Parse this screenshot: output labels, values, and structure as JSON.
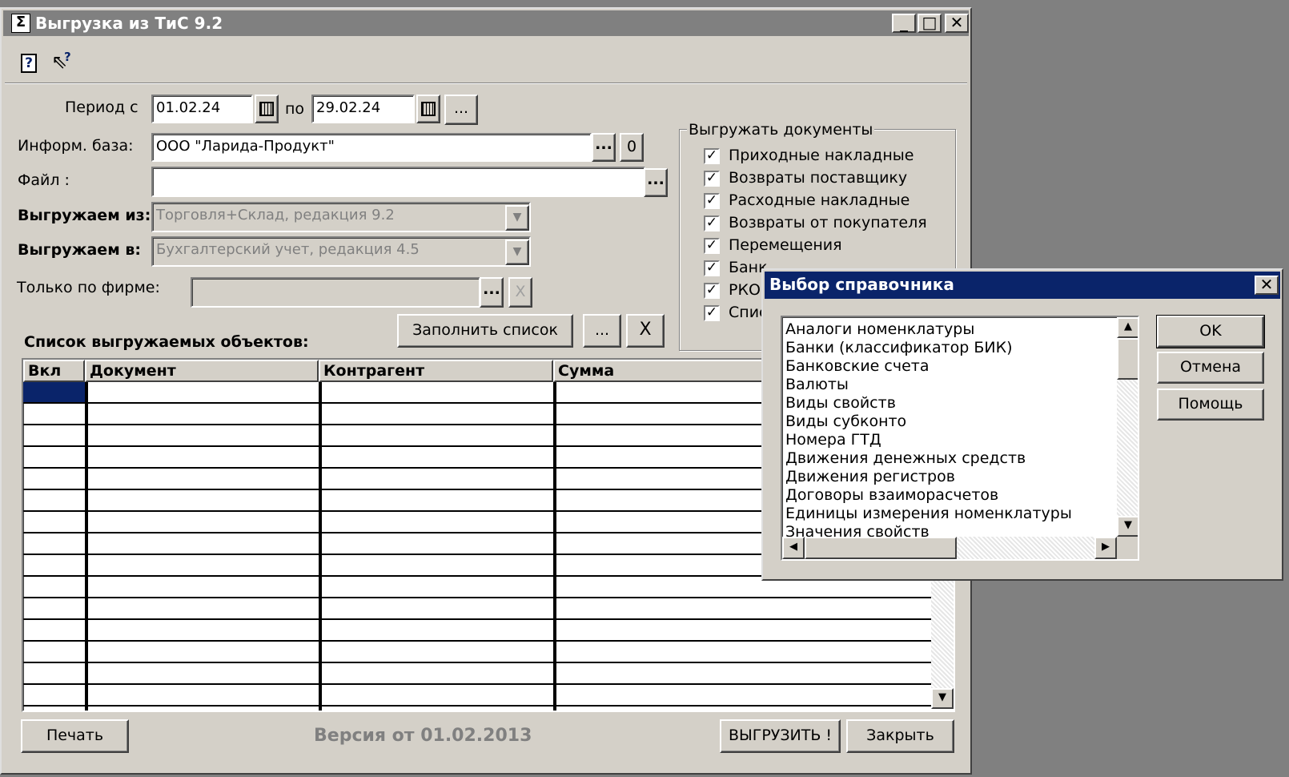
{
  "main_window": {
    "title": "Выгрузка из ТиС 9.2",
    "toolbar": {
      "help_icon": "help-book-icon",
      "whats_this_icon": "whats-this-cursor-icon"
    },
    "period_label": "Период с",
    "period_from": "01.02.24",
    "period_to_label": "по",
    "period_to": "29.02.24",
    "ellipsis": "...",
    "info_base_label": "Информ. база:",
    "info_base_value": "ООО \"Ларида-Продукт\"",
    "info_base_zero": "0",
    "file_label": "Файл :",
    "file_value": "",
    "export_from_label": "Выгружаем из:",
    "export_from_value": "Торговля+Склад, редакция 9.2",
    "export_to_label": "Выгружаем в:",
    "export_to_value": "Бухгалтерский учет, редакция 4.5",
    "only_firm_label": "Только по фирме:",
    "only_firm_value": "",
    "clear_symbol": "X",
    "fill_list_button": "Заполнить список",
    "objects_list_label": "Список выгружаемых объектов:",
    "docs_group": {
      "title": "Выгружать документы",
      "items": [
        {
          "label": "Приходные накладные",
          "checked": true
        },
        {
          "label": "Возвраты поставщику",
          "checked": true
        },
        {
          "label": "Расходные накладные",
          "checked": true
        },
        {
          "label": "Возвраты от покупателя",
          "checked": true
        },
        {
          "label": "Перемещения",
          "checked": true
        },
        {
          "label": "Банк",
          "checked": true
        },
        {
          "label": "РКО",
          "checked": true
        },
        {
          "label": "Спис",
          "checked": true
        }
      ]
    },
    "table": {
      "columns": [
        "Вкл",
        "Документ",
        "Контрагент",
        "Сумма"
      ]
    },
    "print_button": "Печать",
    "version_text": "Версия от 01.02.2013",
    "export_button": "ВЫГРУЗИТЬ !",
    "close_button": "Закрыть"
  },
  "dialog": {
    "title": "Выбор справочника",
    "items": [
      "Аналоги номенклатуры",
      "Банки (классификатор БИК)",
      "Банковские счета",
      "Валюты",
      "Виды свойств",
      "Виды субконто",
      "Номера ГТД",
      "Движения денежных средств",
      "Движения регистров",
      "Договоры взаиморасчетов",
      "Единицы измерения номенклатуры",
      "Значения свойств"
    ],
    "ok_button": "OK",
    "cancel_button": "Отмена",
    "help_button": "Помощь"
  }
}
